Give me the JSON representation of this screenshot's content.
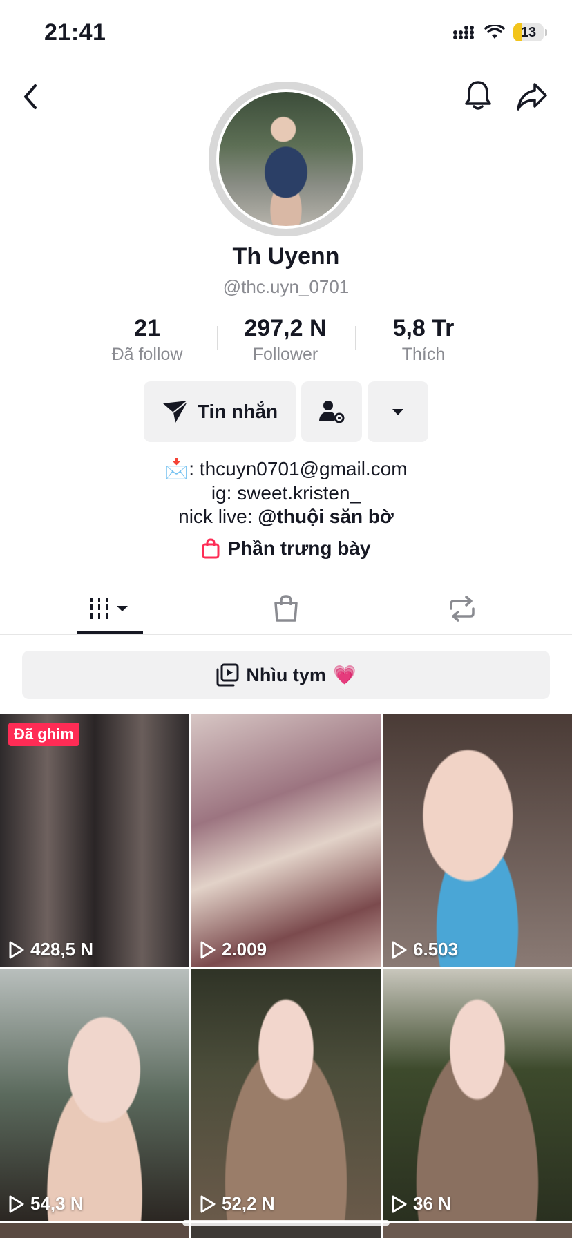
{
  "status_bar": {
    "time": "21:41",
    "battery": "13"
  },
  "profile": {
    "display_name": "Th Uyenn",
    "username": "@thc.uyn_0701",
    "stats": [
      {
        "value": "21",
        "label": "Đã follow"
      },
      {
        "value": "297,2 N",
        "label": "Follower"
      },
      {
        "value": "5,8 Tr",
        "label": "Thích"
      }
    ]
  },
  "actions": {
    "message_label": "Tin nhắn"
  },
  "bio": {
    "line1_emoji": "📩",
    "line1_text": ": thcuyn0701@gmail.com",
    "line2": "ig: sweet.kristen_",
    "line3_prefix": "nick live: ",
    "line3_mention": "@thuội săn bờ"
  },
  "showcase_label": "Phần trưng bày",
  "playlist": {
    "label": "Nhìu tym",
    "emoji": "💗"
  },
  "videos": [
    {
      "views": "428,5 N",
      "pinned_label": "Đã ghim"
    },
    {
      "views": "2.009"
    },
    {
      "views": "6.503"
    },
    {
      "views": "54,3 N"
    },
    {
      "views": "52,2 N"
    },
    {
      "views": "36 N"
    }
  ],
  "colors": {
    "accent": "#fe2c55",
    "text": "#161823",
    "muted": "#8a8b91",
    "button_bg": "#f1f1f2"
  }
}
